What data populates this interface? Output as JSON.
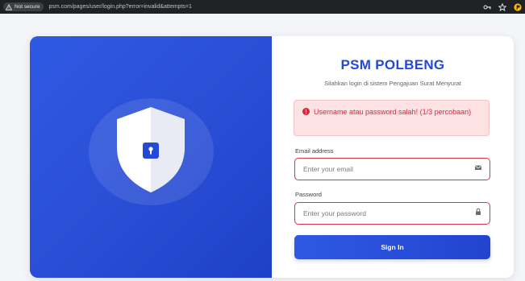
{
  "browser": {
    "security_label": "Not secure",
    "url": "psm.com/pages/user/login.php?error=invalid&attempts=1"
  },
  "login": {
    "brand": "PSM POLBENG",
    "subtitle": "Silahkan login di sistem Pengajuan Surat Menyurat",
    "alert": "Username atau password salah! (1/3 percobaan)",
    "email_label": "Email address",
    "email_placeholder": "Enter your email",
    "password_label": "Password",
    "password_placeholder": "Enter your password",
    "signin_label": "Sign In"
  },
  "icons": {
    "security": "warning-triangle-icon",
    "translate": "translate-icon",
    "bookmark": "star-icon",
    "extension": "extension-icon",
    "shield": "shield-lock-icon",
    "alert": "exclamation-circle-icon",
    "email": "envelope-icon",
    "password": "lock-icon"
  },
  "colors": {
    "brand": "#2448d8",
    "panel_blue": "#2a4fd6",
    "error": "#dc3545",
    "alert_bg": "#fde2e4"
  }
}
